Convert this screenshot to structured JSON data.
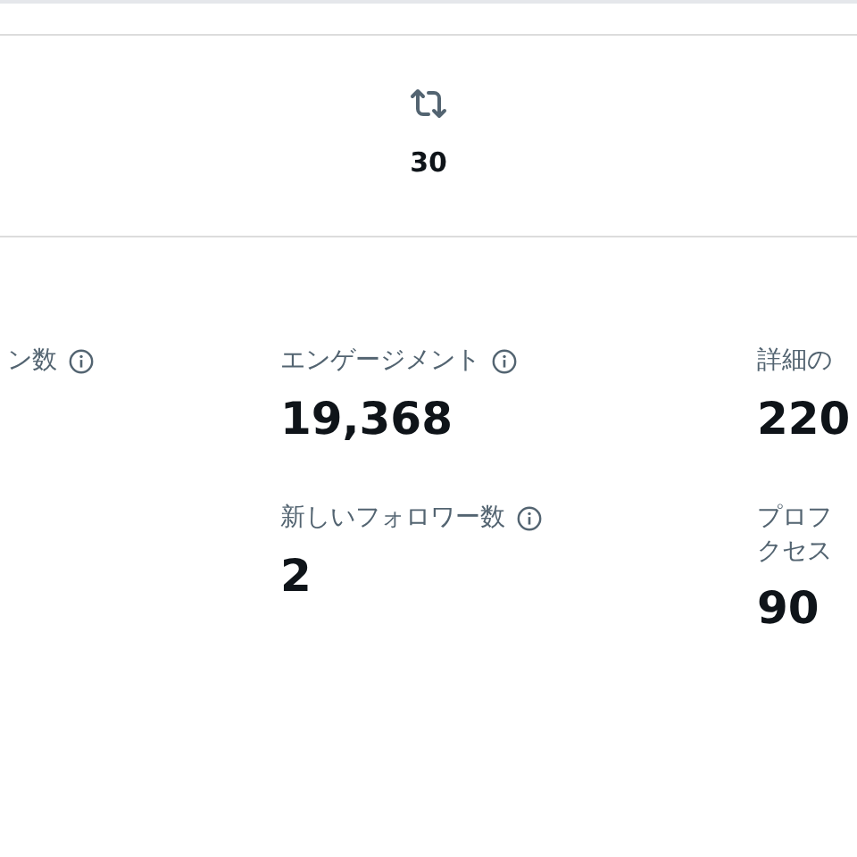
{
  "reposts": {
    "count": "30"
  },
  "metric_rows": [
    [
      {
        "label_lines": [
          "ン数"
        ],
        "info": true
      },
      {
        "label_lines": [
          "エンゲージメント"
        ],
        "info": true,
        "value": "19,368"
      },
      {
        "label_lines": [
          "詳細の"
        ],
        "info": false,
        "value": "220"
      }
    ],
    [
      {
        "label_lines": [
          "新しいフォロワー数"
        ],
        "info": true,
        "value": "2"
      },
      {
        "label_lines": [
          "プロフ",
          "クセス"
        ],
        "info": false,
        "value": "90"
      }
    ]
  ]
}
